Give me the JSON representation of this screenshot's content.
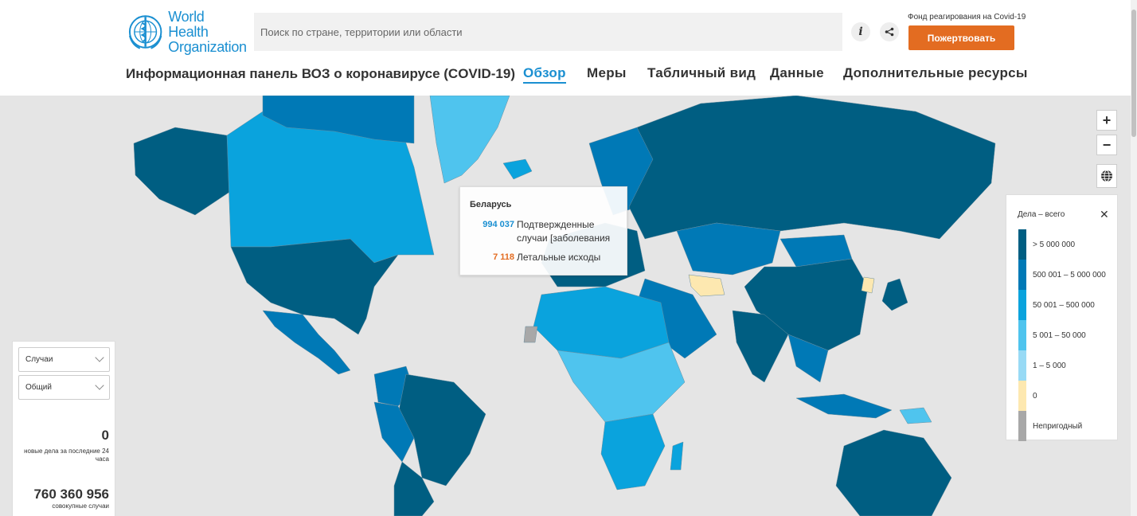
{
  "header": {
    "logo_line1": "World Health",
    "logo_line2": "Organization",
    "search_placeholder": "Поиск по стране, территории или области",
    "info_icon": "info-icon",
    "share_icon": "share-icon",
    "fund_label": "Фонд реагирования на Covid-19",
    "donate_label": "Пожертвовать",
    "dashboard_title": "Информационная панель ВОЗ о коронавирусе (COVID-19)"
  },
  "nav": {
    "overview": "Обзор",
    "measures": "Меры",
    "table": "Табличный вид",
    "data": "Данные",
    "resources": "Дополнительные ресурсы"
  },
  "map_controls": {
    "zoom_in": "+",
    "zoom_out": "−",
    "globe_icon": "globe-icon"
  },
  "tooltip": {
    "country": "Беларусь",
    "confirmed_value": "994 037",
    "confirmed_label": "Подтвержденные случаи [заболевания",
    "deaths_value": "7 118",
    "deaths_label": "Летальные исходы"
  },
  "legend": {
    "title": "Дела – всего",
    "items": [
      {
        "label": "> 5 000 000",
        "color": "#005e82"
      },
      {
        "label": "500 001 – 5 000 000",
        "color": "#0079b6"
      },
      {
        "label": "50 001 – 500 000",
        "color": "#0aa3dd"
      },
      {
        "label": "5 001 – 50 000",
        "color": "#4fc4ee"
      },
      {
        "label": "1 – 5 000",
        "color": "#98daf5"
      },
      {
        "label": "0",
        "color": "#fde8b0"
      },
      {
        "label": "Непригодный",
        "color": "#a8a8a8"
      }
    ]
  },
  "left_panel": {
    "select1": "Случаи",
    "select2": "Общий",
    "new_cases_value": "0",
    "new_cases_label": "новые дела за последние 24 часа",
    "total_cases_value": "760 360 956",
    "total_cases_label": "совокупные случаи"
  },
  "colors": {
    "accent": "#1a8fd1",
    "donate": "#e36c21",
    "map_bg": "#e5e5e5",
    "death_value": "#e36c21",
    "confirmed_value": "#1a8fd1"
  }
}
